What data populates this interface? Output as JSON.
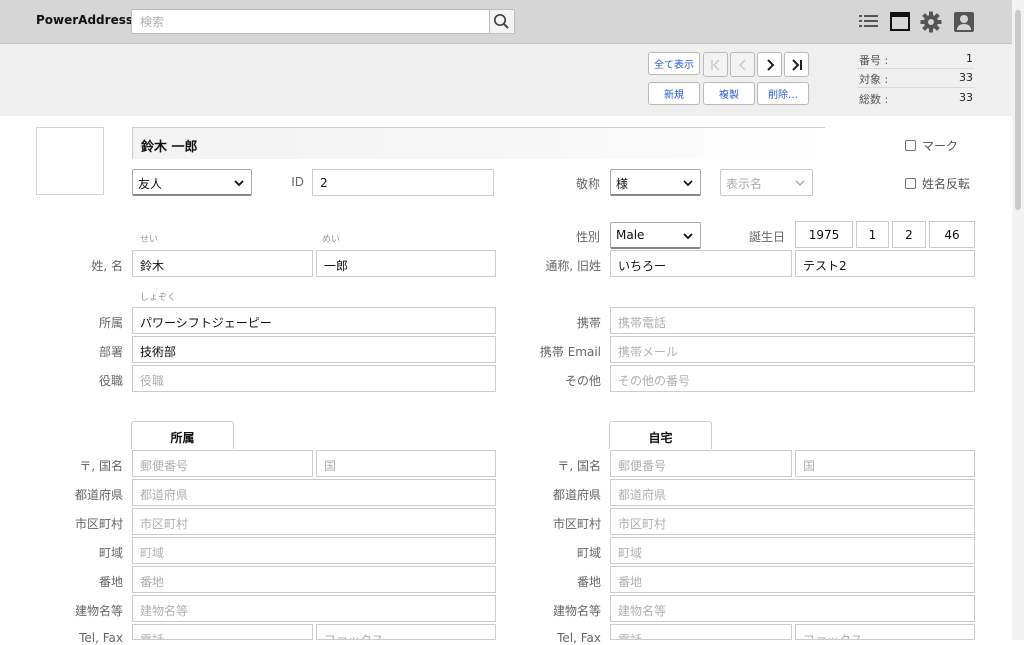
{
  "app": {
    "title": "PowerAddress"
  },
  "search": {
    "placeholder": "検索"
  },
  "toolbar": {
    "show_all": "全て表示",
    "new": "新規",
    "duplicate": "複製",
    "delete": "削除…",
    "info": [
      {
        "label": "番号 :",
        "value": "1"
      },
      {
        "label": "対象 :",
        "value": "33"
      },
      {
        "label": "総数 :",
        "value": "33"
      }
    ]
  },
  "record": {
    "full_name": "鈴木 一郎",
    "mark_label": "マーク",
    "name_reverse_label": "姓名反転",
    "group": "友人",
    "id_label": "ID",
    "id_value": "2",
    "honorific_label": "敬称",
    "honorific_value": "様",
    "display_name_placeholder": "表示名",
    "furigana_last": "せい",
    "furigana_first": "めい",
    "name_label": "姓, 名",
    "last_name": "鈴木",
    "first_name": "一郎",
    "gender_label": "性別",
    "gender_value": "Male",
    "birthday_label": "誕生日",
    "birth_year": "1975",
    "birth_month": "1",
    "birth_day": "2",
    "age": "46",
    "nickname_label": "通称, 旧姓",
    "nickname": "いちろー",
    "old_name": "テスト2",
    "furigana_company": "しょぞく",
    "company_label": "所属",
    "company": "パワーシフトジェーピー",
    "dept_label": "部署",
    "dept": "技術部",
    "title_label": "役職",
    "title_placeholder": "役職",
    "mobile_label": "携帯",
    "mobile_placeholder": "携帯電話",
    "mobile_email_label": "携帯 Email",
    "mobile_email_placeholder": "携帯メール",
    "other_label": "その他",
    "other_placeholder": "その他の番号"
  },
  "work_address": {
    "tab": "所属",
    "postal_label": "〒, 国名",
    "postal_placeholder": "郵便番号",
    "country_placeholder": "国",
    "pref_label": "都道府県",
    "pref_placeholder": "都道府県",
    "city_label": "市区町村",
    "city_placeholder": "市区町村",
    "town_label": "町域",
    "town_placeholder": "町域",
    "banchi_label": "番地",
    "banchi_placeholder": "番地",
    "building_label": "建物名等",
    "building_placeholder": "建物名等",
    "tel_label": "Tel, Fax",
    "tel_placeholder": "電話",
    "fax_placeholder": "ファックス"
  },
  "home_address": {
    "tab": "自宅",
    "postal_label": "〒, 国名",
    "postal_placeholder": "郵便番号",
    "country_placeholder": "国",
    "pref_label": "都道府県",
    "pref_placeholder": "都道府県",
    "city_label": "市区町村",
    "city_placeholder": "市区町村",
    "town_label": "町域",
    "town_placeholder": "町域",
    "banchi_label": "番地",
    "banchi_placeholder": "番地",
    "building_label": "建物名等",
    "building_placeholder": "建物名等",
    "tel_label": "Tel, Fax",
    "tel_placeholder": "電話",
    "fax_placeholder": "ファックス"
  },
  "icons": [
    "search-icon",
    "list-icon",
    "window-icon",
    "gear-icon",
    "user-icon",
    "first-icon",
    "prev-icon",
    "next-icon",
    "last-icon",
    "chevron-down-icon"
  ]
}
